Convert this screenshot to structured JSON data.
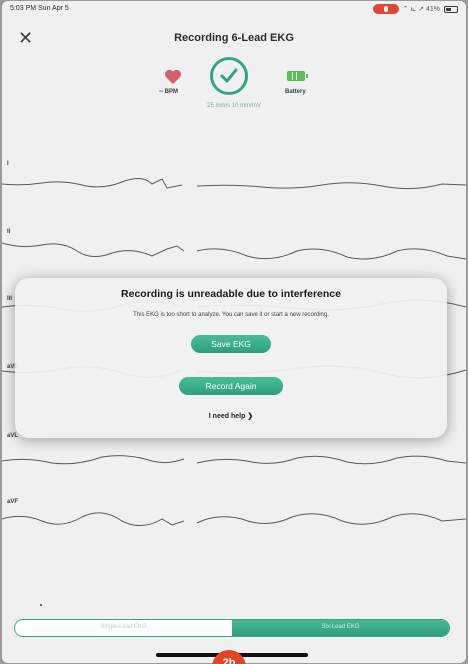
{
  "status_bar": {
    "time": "5:03 PM  Sun Apr 5",
    "signal": "⌃ ⊾ ↗ 41%"
  },
  "header": {
    "close_icon": "close-icon",
    "title": "Recording 6-Lead EKG"
  },
  "metrics": {
    "bpm_label": "-- BPM",
    "speed": "25 mm/s   10 mm/mV",
    "battery_label": "Battery"
  },
  "leads": [
    "I",
    "II",
    "III",
    "aVR",
    "aVL",
    "aVF"
  ],
  "dialog": {
    "title": "Recording is unreadable due to interference",
    "body": "This EKG is too short to analyze. You can save it or start a new recording.",
    "save_label": "Save EKG",
    "record_again_label": "Record Again",
    "help_label": "I need help"
  },
  "segmented": {
    "left": "Single-Lead EKG",
    "right": "Six-Lead EKG"
  },
  "badge": "2b",
  "colors": {
    "accent": "#34a583",
    "heart": "#e05a6a",
    "battery": "#5cc25a",
    "record_pill": "#e8432e"
  }
}
